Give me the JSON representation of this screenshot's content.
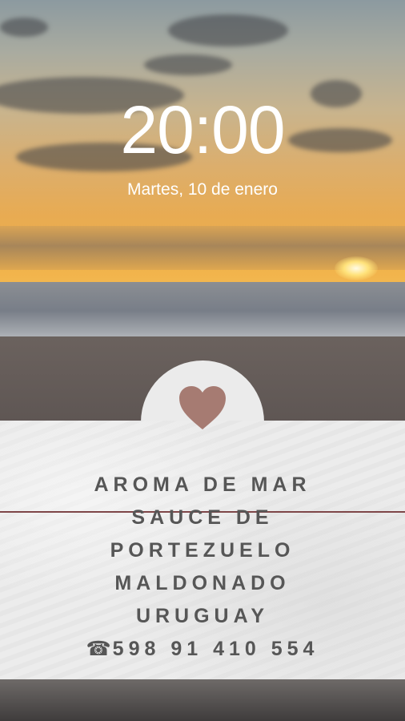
{
  "lock_screen": {
    "time": "20:00",
    "date": "Martes, 10 de enero"
  },
  "card": {
    "icon": "heart-icon",
    "heart_color": "#a67b72",
    "lines": [
      "AROMA DE MAR",
      "SAUCE DE",
      "PORTEZUELO",
      "MALDONADO",
      "URUGUAY"
    ],
    "phone_icon": "☎",
    "phone": "598 91 410 554"
  }
}
